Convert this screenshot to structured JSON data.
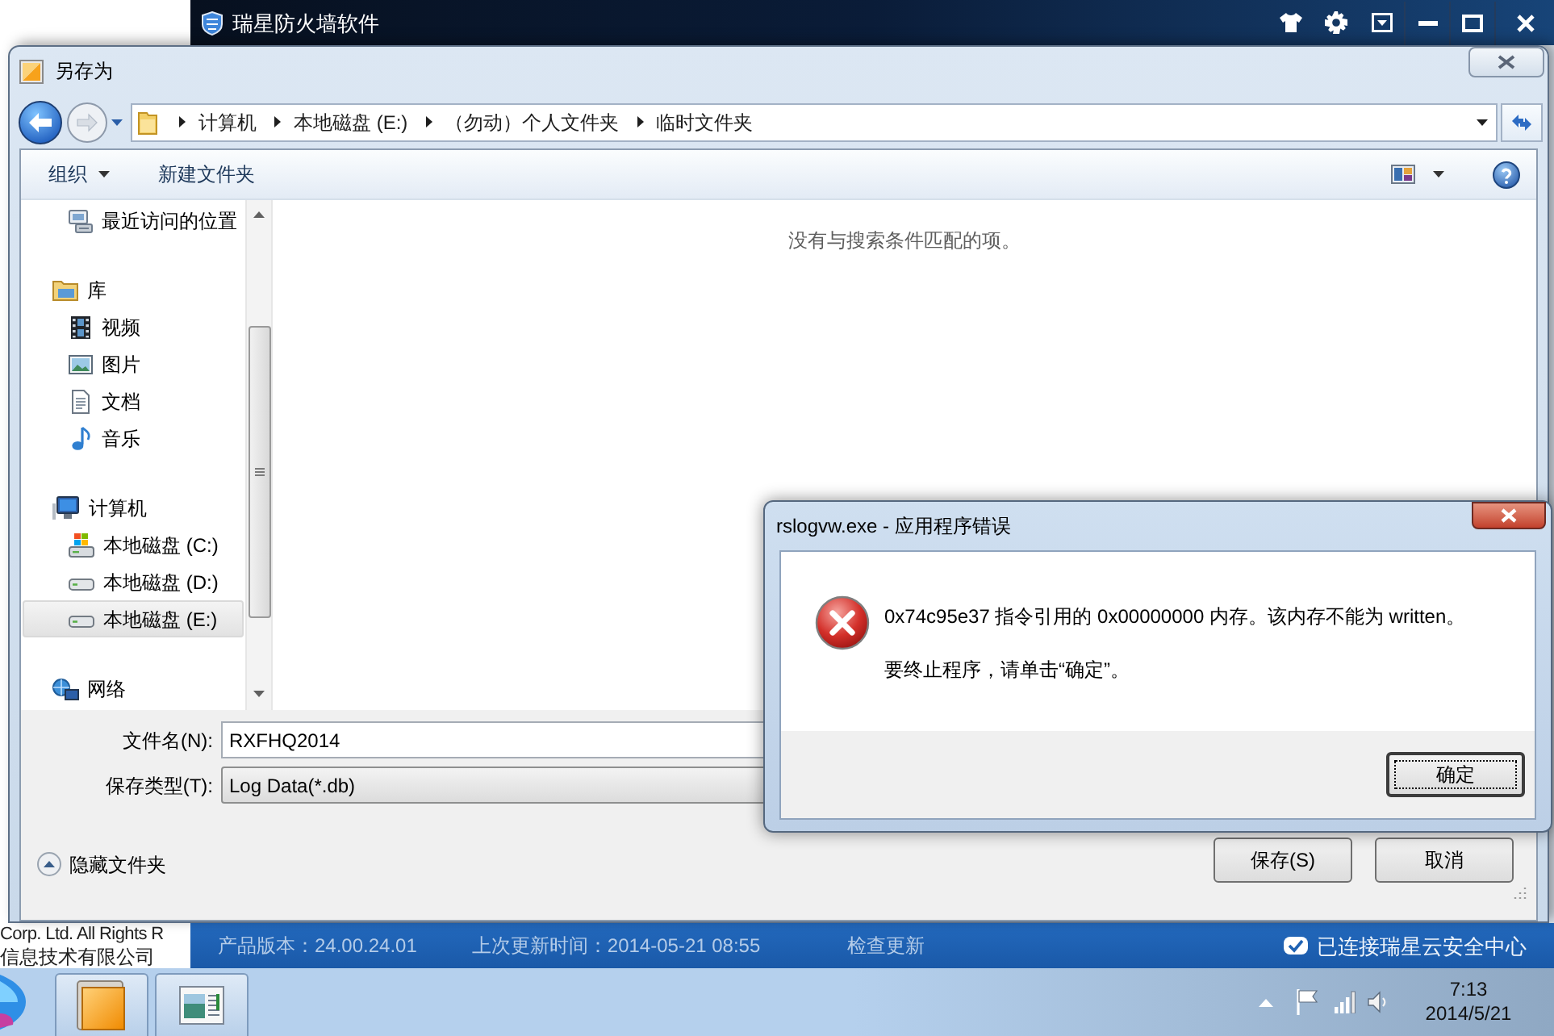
{
  "background_window": {
    "copyright_lines": [
      "Corp. Ltd. All Rights R",
      "信息技术有限公司"
    ]
  },
  "firewall_window": {
    "title": "瑞星防火墙软件",
    "status_bar": {
      "version": "产品版本：24.00.24.01",
      "last_update": "上次更新时间：2014-05-21 08:55",
      "check_update": "检查更新",
      "cloud_status": "已连接瑞星云安全中心"
    }
  },
  "save_dialog": {
    "title": "另存为",
    "path": [
      "计算机",
      "本地磁盘 (E:)",
      "（勿动）个人文件夹",
      "临时文件夹"
    ],
    "toolbar": {
      "organize": "组织",
      "new_folder": "新建文件夹"
    },
    "nav_pane": {
      "groups": [
        {
          "children": [
            {
              "kind": "recent",
              "label": "最近访问的位置",
              "selected": false
            }
          ]
        },
        {
          "kind": "library",
          "label": "库",
          "selected": false,
          "children": [
            {
              "kind": "video",
              "label": "视频",
              "selected": false
            },
            {
              "kind": "pictures",
              "label": "图片",
              "selected": false
            },
            {
              "kind": "documents",
              "label": "文档",
              "selected": false
            },
            {
              "kind": "music",
              "label": "音乐",
              "selected": false
            }
          ]
        },
        {
          "kind": "computer",
          "label": "计算机",
          "selected": false,
          "children": [
            {
              "kind": "system_drive",
              "label": "本地磁盘 (C:)",
              "selected": false
            },
            {
              "kind": "drive",
              "label": "本地磁盘 (D:)",
              "selected": false
            },
            {
              "kind": "drive",
              "label": "本地磁盘 (E:)",
              "selected": true
            }
          ]
        },
        {
          "kind": "network",
          "label": "网络",
          "selected": false
        }
      ]
    },
    "empty_message": "没有与搜索条件匹配的项。",
    "file_name": {
      "label": "文件名(N):",
      "value": "RXFHQ2014"
    },
    "file_type": {
      "label": "保存类型(T):",
      "value": "Log Data(*.db)"
    },
    "hide_folders": "隐藏文件夹",
    "buttons": [
      "保存(S)",
      "取消"
    ]
  },
  "error_dialog": {
    "title": "rslogvw.exe - 应用程序错误",
    "message": [
      "0x74c95e37 指令引用的 0x00000000 内存。该内存不能为 written。",
      "要终止程序，请单击“确定”。"
    ],
    "button": {
      "label": "确定",
      "focused": true
    }
  },
  "taskbar": {
    "tasks": [
      {
        "kind": "box"
      },
      {
        "kind": "window"
      }
    ],
    "clock": {
      "time": "7:13",
      "date": "2014/5/21"
    }
  }
}
